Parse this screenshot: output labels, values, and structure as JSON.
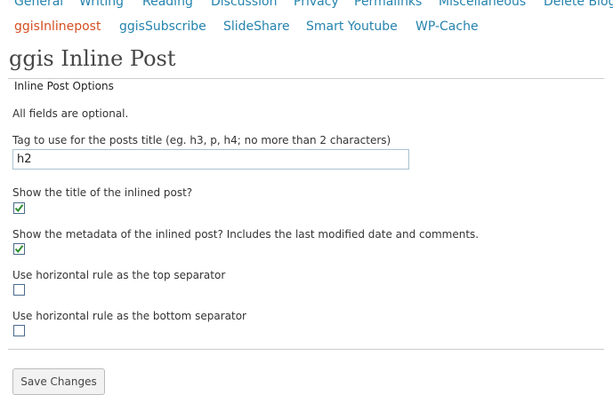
{
  "tabs_primary": [
    "General",
    "Writing",
    "Reading",
    "Discussion",
    "Privacy",
    "Permalinks",
    "Miscellaneous",
    "Delete Blog"
  ],
  "tabs_secondary": [
    {
      "label": "ggisInlinepost",
      "active": true
    },
    {
      "label": "ggisSubscribe",
      "active": false
    },
    {
      "label": "SlideShare",
      "active": false
    },
    {
      "label": "Smart Youtube",
      "active": false
    },
    {
      "label": "WP-Cache",
      "active": false
    }
  ],
  "page_title": "ggis Inline Post",
  "section_title": "Inline Post Options",
  "note": "All fields are optional.",
  "tag_field": {
    "label": "Tag to use for the posts title (eg. h3, p, h4; no more than 2 characters)",
    "value": "h2"
  },
  "options": [
    {
      "label": "Show the title of the inlined post?",
      "checked": true
    },
    {
      "label": "Show the metadata of the inlined post? Includes the last modified date and comments.",
      "checked": true
    },
    {
      "label": "Use horizontal rule as the top separator",
      "checked": false
    },
    {
      "label": "Use horizontal rule as the bottom separator",
      "checked": false
    }
  ],
  "save_label": "Save Changes",
  "colors": {
    "link": "#2583ad",
    "active_link": "#d54e21",
    "check": "#2c8c2c"
  }
}
